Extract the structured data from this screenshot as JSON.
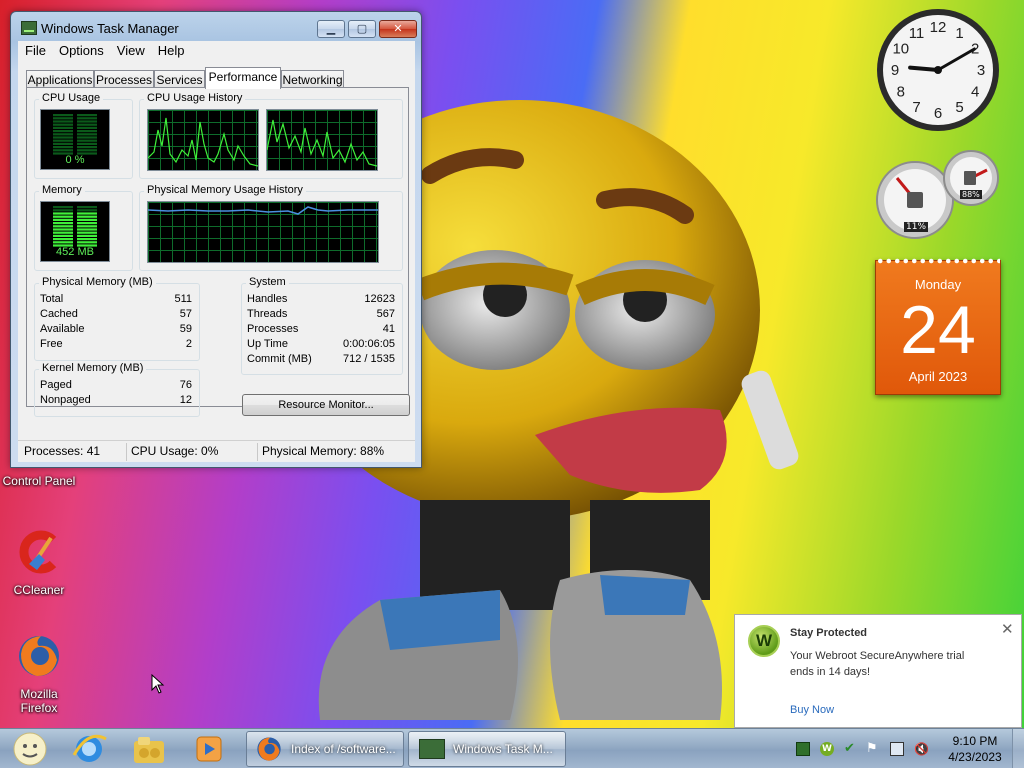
{
  "task_manager": {
    "title": "Windows Task Manager",
    "menu": [
      "File",
      "Options",
      "View",
      "Help"
    ],
    "tabs": [
      "Applications",
      "Processes",
      "Services",
      "Performance",
      "Networking"
    ],
    "active_tab": "Performance",
    "cpu_usage": {
      "title": "CPU Usage",
      "value": "0 %",
      "fraction": 0.0
    },
    "cpu_history": {
      "title": "CPU Usage History"
    },
    "memory": {
      "title": "Memory",
      "value": "452 MB",
      "fraction": 0.88
    },
    "memory_history": {
      "title": "Physical Memory Usage History"
    },
    "physical_memory": {
      "title": "Physical Memory (MB)",
      "rows": [
        {
          "label": "Total",
          "value": "511"
        },
        {
          "label": "Cached",
          "value": "57"
        },
        {
          "label": "Available",
          "value": "59"
        },
        {
          "label": "Free",
          "value": "2"
        }
      ]
    },
    "system": {
      "title": "System",
      "rows": [
        {
          "label": "Handles",
          "value": "12623"
        },
        {
          "label": "Threads",
          "value": "567"
        },
        {
          "label": "Processes",
          "value": "41"
        },
        {
          "label": "Up Time",
          "value": "0:00:06:05"
        },
        {
          "label": "Commit (MB)",
          "value": "712 / 1535"
        }
      ]
    },
    "kernel_memory": {
      "title": "Kernel Memory (MB)",
      "rows": [
        {
          "label": "Paged",
          "value": "76"
        },
        {
          "label": "Nonpaged",
          "value": "12"
        }
      ]
    },
    "resource_monitor_button": "Resource Monitor...",
    "status": {
      "processes": "Processes: 41",
      "cpu": "CPU Usage: 0%",
      "memory": "Physical Memory: 88%"
    }
  },
  "desktop_icons": [
    {
      "label": "Control Panel",
      "icon": "control-panel-icon"
    },
    {
      "label": "CCleaner",
      "icon": "ccleaner-icon"
    },
    {
      "label": "Mozilla Firefox",
      "icon": "firefox-icon"
    }
  ],
  "gadgets": {
    "clock": {
      "hour": 9,
      "minute": 10
    },
    "meter": {
      "cpu": "11%",
      "memory": "88%"
    },
    "calendar": {
      "day": "Monday",
      "date": "24",
      "month": "April 2023"
    }
  },
  "notification": {
    "title": "Stay Protected",
    "body": "Your Webroot SecureAnywhere trial ends in 14 days!",
    "link": "Buy Now",
    "logo_letter": "W"
  },
  "taskbar": {
    "pinned": [
      "user-avatar-icon",
      "internet-explorer-icon",
      "windows-explorer-icon",
      "media-player-icon"
    ],
    "tasks": [
      {
        "label": "Index of /software...",
        "icon": "firefox-icon"
      },
      {
        "label": "Windows Task M...",
        "icon": "task-manager-icon"
      }
    ],
    "time": "9:10 PM",
    "date": "4/23/2023"
  },
  "colors": {
    "graph_line": "#3ff03a",
    "memory_line": "#4a8fe0",
    "calendar": "#e8650f",
    "link": "#2a6bbd"
  }
}
